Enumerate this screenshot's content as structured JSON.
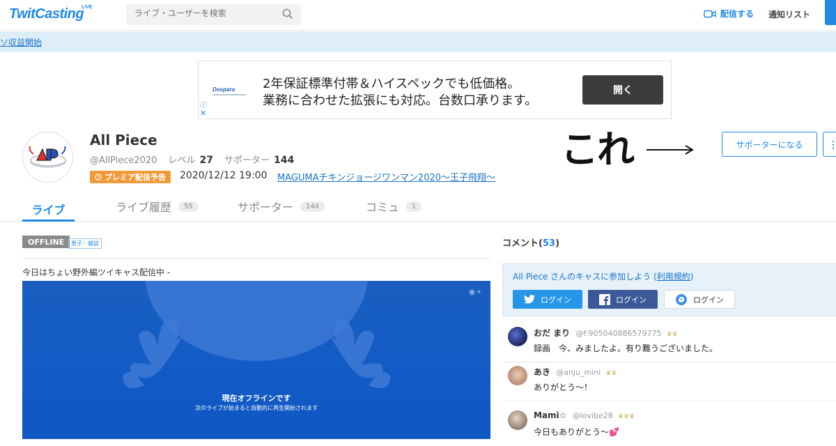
{
  "header": {
    "logo": "TwitCasting",
    "logo_live": "LIVE",
    "search_placeholder": "ライブ・ユーザーを検索",
    "broadcast_label": "配信する",
    "notify_label": "通知リスト"
  },
  "infobar": {
    "link": "ソ収益開始"
  },
  "ad": {
    "logo": "Dospara",
    "line1": "2年保証標準付帯＆ハイスペックでも低価格。",
    "line2": "業務に合わせた拡張にも対応。台数口承ります。",
    "button": "開く",
    "info_icon": "ⓘ",
    "close_icon": "✕"
  },
  "profile": {
    "name": "All Piece",
    "handle": "@AllPiece2020",
    "level_label": "レベル",
    "level": "27",
    "supporter_label": "サポーター",
    "supporters": "144",
    "premiere_badge": "プレミア配信予告",
    "premiere_date": "2020/12/12 19:00",
    "premiere_title": "MAGUMAチキンジョージワンマン2020〜王子飛翔〜",
    "support_button": "サポーターになる",
    "more_button": "⋮",
    "annotation": "これ"
  },
  "tabs": [
    {
      "label": "ライブ"
    },
    {
      "label": "ライブ履歴",
      "count": "55"
    },
    {
      "label": "サポーター",
      "count": "144"
    },
    {
      "label": "コミュ",
      "count": "1"
    }
  ],
  "stream": {
    "status": "OFFLINE",
    "category": "男子：雑談",
    "description": "今日はちょい野外編ツイキャス配信中 -",
    "offline_title": "現在オフラインです",
    "offline_sub": "次のライブが始まると自動的に再生開始されます"
  },
  "comments": {
    "header_label": "コメント",
    "count": "53",
    "join_text": "All Piece さんのキャスに参加しよう",
    "terms_link": "利用規約",
    "login_twitter": "ログイン",
    "login_facebook": "ログイン",
    "login_twitcas": "ログイン",
    "items": [
      {
        "name": "おだ まり",
        "id": "@f:905040886579775",
        "crowns": "♛♛",
        "text": "録画　今、みましたよ。有り難うございました。"
      },
      {
        "name": "あき",
        "id": "@anju_mini",
        "crowns": "♛♛",
        "text": "ありがとう〜！"
      },
      {
        "name": "Mami☆",
        "id": "@lovibe28",
        "crowns": "♛♛♛",
        "text": "今日もありがとう〜💕"
      }
    ]
  },
  "colors": {
    "accent": "#1e88e5",
    "premiere": "#f19a38",
    "player": "#125bc6"
  }
}
